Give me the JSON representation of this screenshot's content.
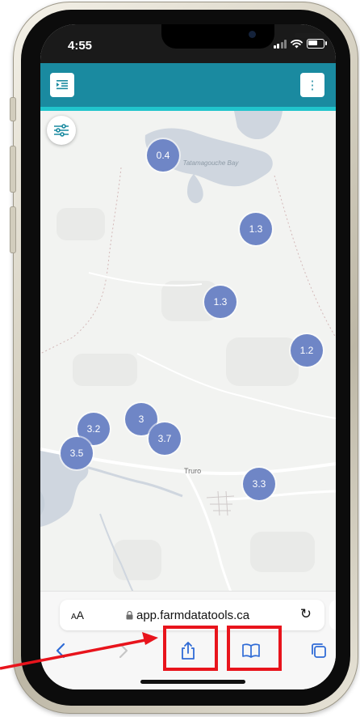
{
  "status_bar": {
    "time": "4:55"
  },
  "app_bar": {
    "menu_icon": "format-indent-icon",
    "more_icon": "vertical-dots-icon",
    "more_glyph": "⋮"
  },
  "map": {
    "place_labels": {
      "bay": "Tatamagouche Bay",
      "town": "Truro"
    },
    "clusters": [
      "0.4",
      "1.3",
      "1.3",
      "1.2",
      "3.2",
      "3",
      "3.7",
      "3.5",
      "3.3"
    ]
  },
  "safari": {
    "text_size_label": "AA",
    "url": "app.farmdatatools.ca",
    "reload_glyph": "↻",
    "toolbar_icons": [
      "back-icon",
      "forward-icon",
      "share-icon",
      "bookmarks-icon",
      "tabs-icon"
    ]
  },
  "colors": {
    "app_bar": "#1a8aa0",
    "app_bar_accent": "#21c4cc",
    "cluster": "#6f86c6",
    "highlight": "#e8141c",
    "water": "#cfd6df"
  }
}
